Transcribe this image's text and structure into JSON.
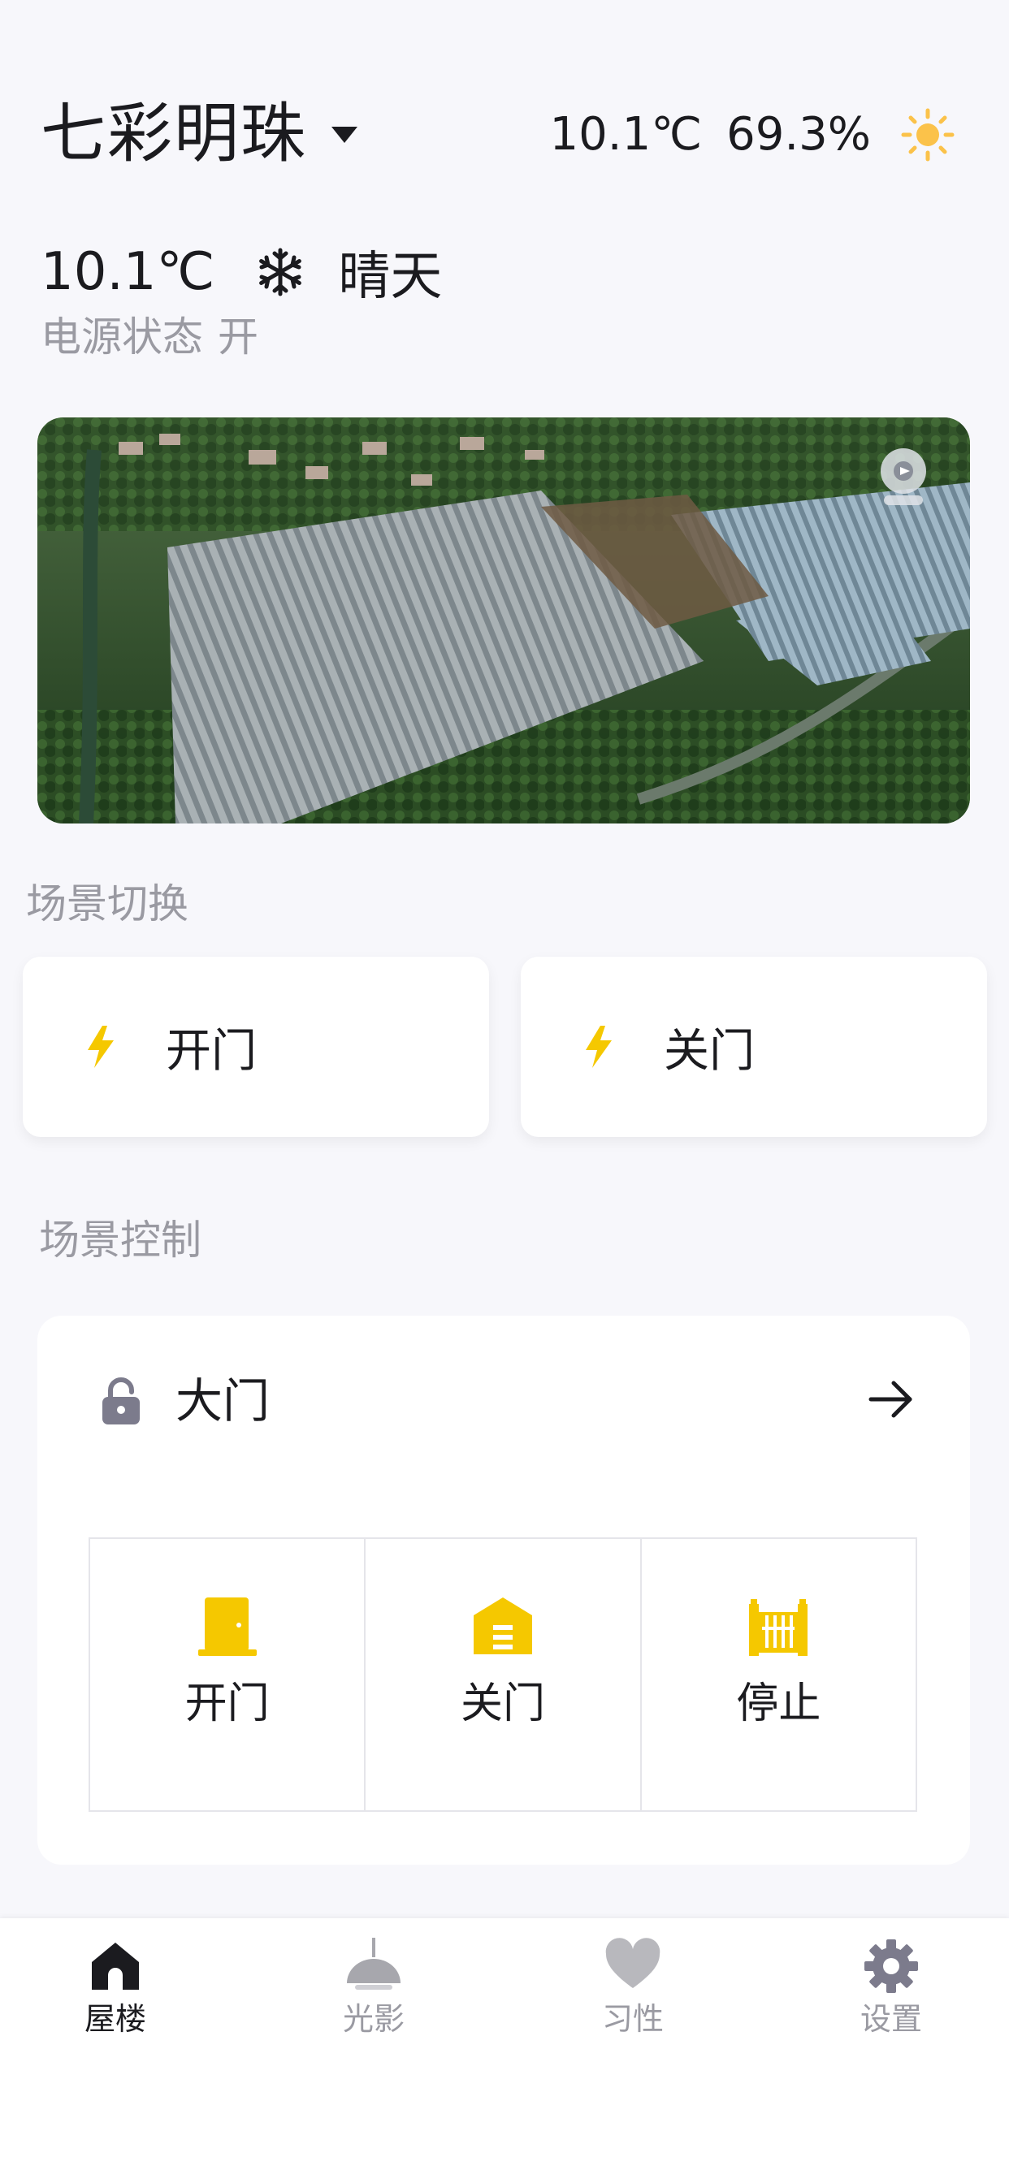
{
  "header": {
    "title": "七彩明珠",
    "temperature": "10.1℃",
    "humidity": "69.3%",
    "weather_icon": "sun-icon"
  },
  "status": {
    "temperature": "10.1℃",
    "mode_icon": "snowflake-icon",
    "condition": "晴天",
    "power_label": "电源状态",
    "power_value": "开"
  },
  "camera": {
    "icon": "camera-icon"
  },
  "scene_switch": {
    "label": "场景切换",
    "items": [
      {
        "label": "开门",
        "icon": "lightning-icon"
      },
      {
        "label": "关门",
        "icon": "lightning-icon"
      }
    ]
  },
  "scene_control": {
    "label": "场景控制",
    "device": {
      "name": "大门",
      "icon": "lock-icon",
      "actions": [
        {
          "label": "开门",
          "icon": "door-icon"
        },
        {
          "label": "关门",
          "icon": "garage-icon"
        },
        {
          "label": "停止",
          "icon": "gate-icon"
        }
      ]
    }
  },
  "tabbar": {
    "items": [
      {
        "label": "屋楼",
        "icon": "home-icon",
        "active": true
      },
      {
        "label": "光影",
        "icon": "lamp-icon",
        "active": false
      },
      {
        "label": "习性",
        "icon": "heart-icon",
        "active": false
      },
      {
        "label": "设置",
        "icon": "gear-icon",
        "active": false
      }
    ]
  },
  "colors": {
    "accent": "#f5c800",
    "text_primary": "#1b1b1f",
    "text_secondary": "#9a9aa2",
    "background": "#f7f7fb",
    "sun": "#fbc24a",
    "tab_inactive": "#a7a7ad"
  }
}
